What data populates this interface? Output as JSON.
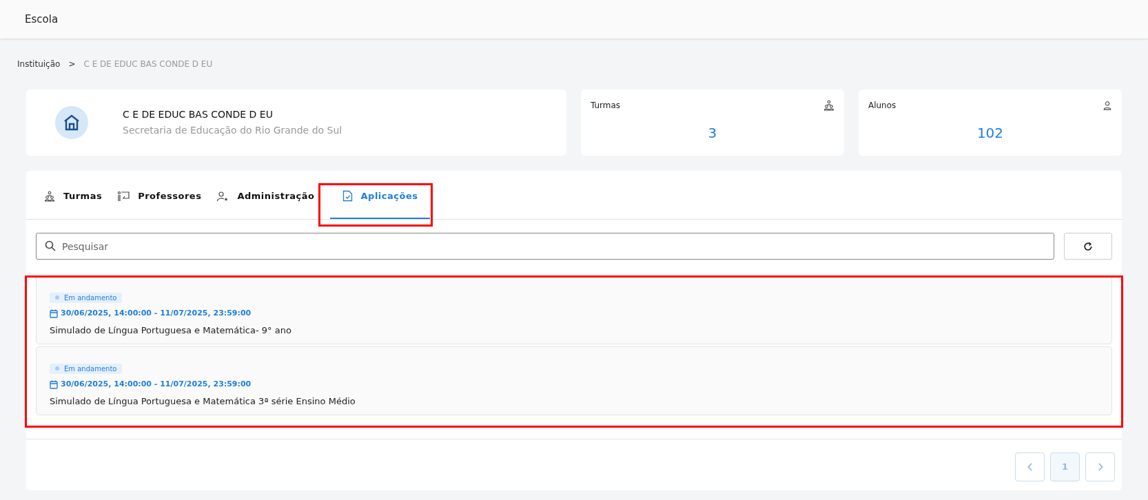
{
  "header": {
    "title": "Escola"
  },
  "breadcrumb": [
    "Instituição",
    "C E DE EDUC BAS CONDE D EU"
  ],
  "breadcrumb_separator": ">",
  "institution": {
    "name": "C E DE EDUC BAS CONDE D EU",
    "subtitle": "Secretaria de Educação do Rio Grande do Sul"
  },
  "stats": [
    {
      "label": "Turmas",
      "value": "3",
      "kind": "group"
    },
    {
      "label": "Alunos",
      "value": "102",
      "kind": "person"
    }
  ],
  "tabs": [
    {
      "label": "Turmas",
      "kind": "group",
      "selected": false
    },
    {
      "label": "Professores",
      "kind": "teacher",
      "selected": false
    },
    {
      "label": "Administração",
      "kind": "admin",
      "selected": false
    },
    {
      "label": "Aplicações",
      "kind": "doc",
      "selected": true
    }
  ],
  "search": {
    "placeholder": "Pesquisar"
  },
  "applications": [
    {
      "status": "Em andamento",
      "dates": "30/06/2025, 14:00:00 - 11/07/2025, 23:59:00",
      "title": "Simulado de Língua Portuguesa e Matemática- 9° ano"
    },
    {
      "status": "Em andamento",
      "dates": "30/06/2025, 14:00:00 - 11/07/2025, 23:59:00",
      "title": "Simulado de Língua Portuguesa e Matemática 3ª série Ensino Médio"
    }
  ],
  "pagination": {
    "disabled": true,
    "pages": [
      {
        "label": "1",
        "selected": true
      }
    ]
  }
}
